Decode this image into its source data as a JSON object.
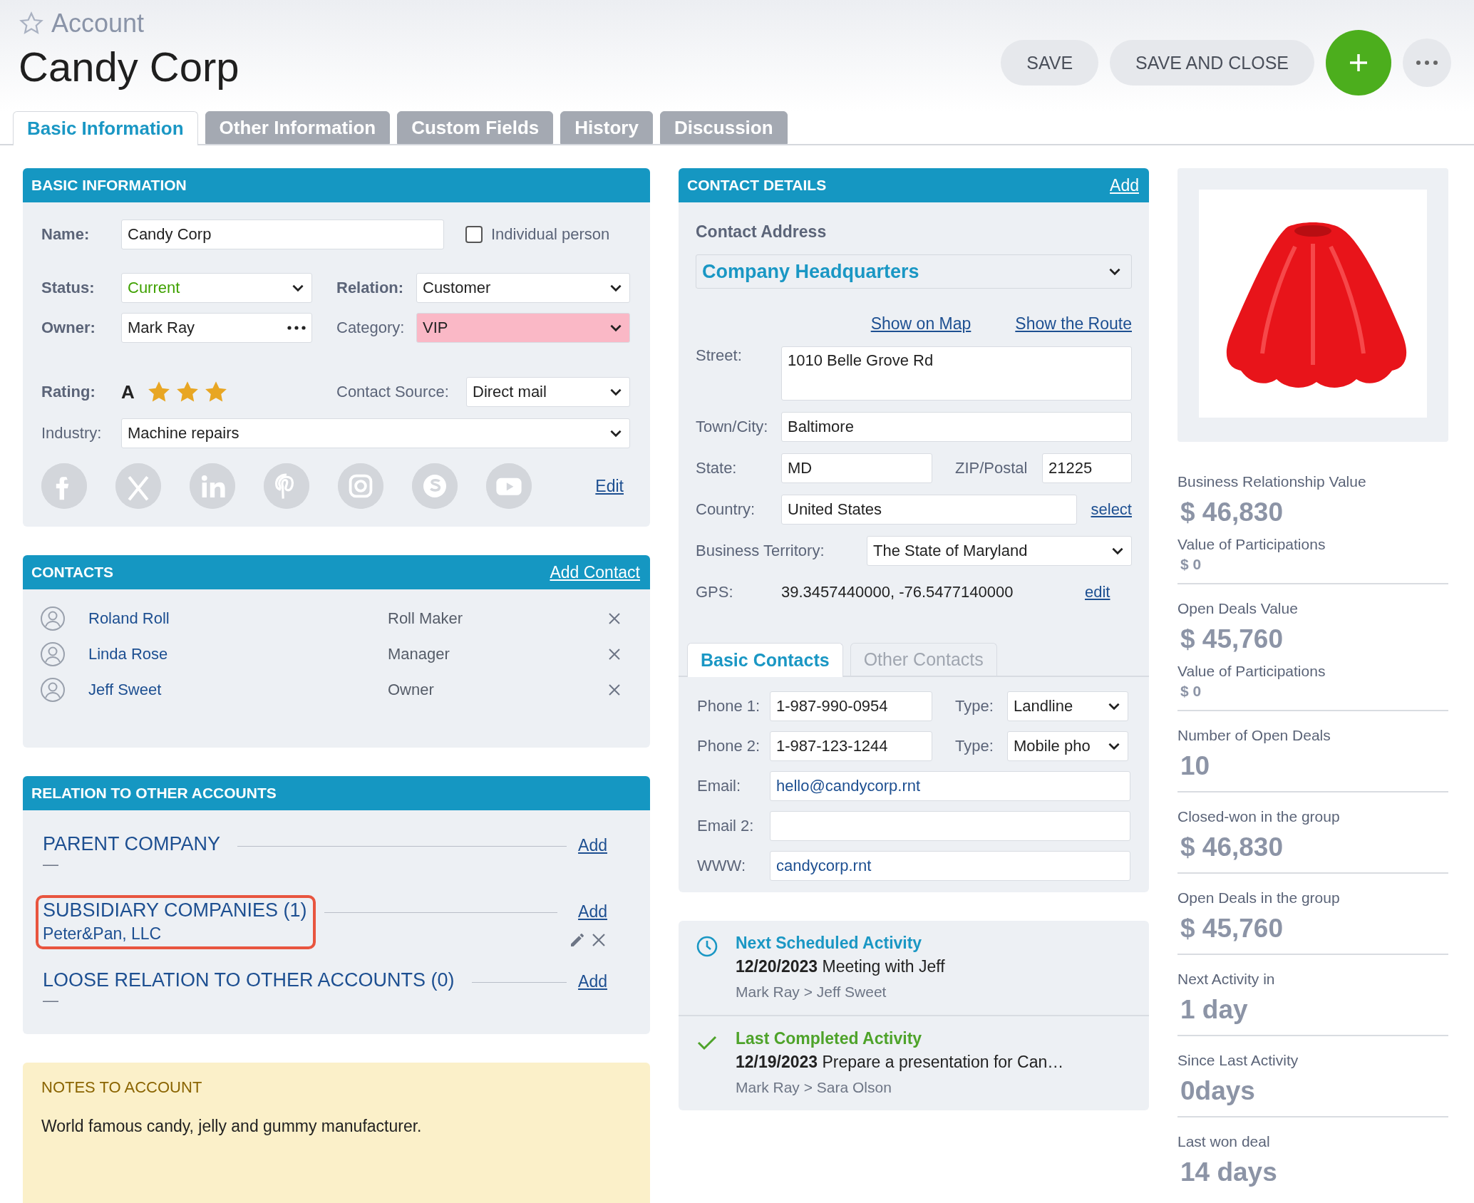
{
  "header": {
    "breadcrumb": "Account",
    "title": "Candy Corp",
    "buttons": [
      "SAVE",
      "SAVE AND CLOSE"
    ]
  },
  "tabs": [
    {
      "label": "Basic Information",
      "selected": true
    },
    {
      "label": "Other Information",
      "selected": false
    },
    {
      "label": "Custom Fields",
      "selected": false
    },
    {
      "label": "History",
      "selected": false
    },
    {
      "label": "Discussion",
      "selected": false
    }
  ],
  "basic_information": {
    "title": "BASIC INFORMATION",
    "name": {
      "label": "Name:",
      "value": "Candy Corp"
    },
    "individual_person": {
      "label": "Individual person",
      "checked": false
    },
    "status": {
      "label": "Status:",
      "value": "Current",
      "color": "#3fa100"
    },
    "relation": {
      "label": "Relation:",
      "value": "Customer"
    },
    "owner": {
      "label": "Owner:",
      "value": "Mark Ray"
    },
    "category": {
      "label": "Category:",
      "value": "VIP",
      "color": "#fab8c6"
    },
    "rating": {
      "label": "Rating:",
      "grade": "A",
      "stars": 3
    },
    "contact_source": {
      "label": "Contact Source:",
      "value": "Direct mail"
    },
    "industry": {
      "label": "Industry:",
      "value": "Machine repairs"
    },
    "edit_link": "Edit"
  },
  "contacts": {
    "title": "CONTACTS",
    "add_link": "Add Contact",
    "rows": [
      {
        "name": "Roland Roll",
        "role": "Roll Maker"
      },
      {
        "name": "Linda Rose",
        "role": "Manager"
      },
      {
        "name": "Jeff Sweet",
        "role": "Owner"
      }
    ]
  },
  "relations": {
    "title": "RELATION TO OTHER ACCOUNTS",
    "sections": [
      {
        "title": "PARENT COMPANY",
        "add_link": "Add",
        "value": "—",
        "highlighted": false
      },
      {
        "title": "SUBSIDIARY COMPANIES (1)",
        "add_link": "Add",
        "items": [
          "Peter&Pan, LLC"
        ],
        "highlighted": true
      },
      {
        "title": "LOOSE RELATION TO OTHER ACCOUNTS (0)",
        "add_link": "Add",
        "value": "—",
        "highlighted": false
      }
    ]
  },
  "notes": {
    "title": "NOTES TO ACCOUNT",
    "text": "World famous candy, jelly and gummy manufacturer."
  },
  "contact_details": {
    "title": "CONTACT DETAILS",
    "add_link": "Add",
    "address_label": "Contact Address",
    "address": "Company Headquarters",
    "links": [
      "Show on Map",
      "Show the Route"
    ],
    "street": {
      "label": "Street:",
      "value": "1010 Belle Grove Rd"
    },
    "city": {
      "label": "Town/City:",
      "value": "Baltimore"
    },
    "state": {
      "label": "State:",
      "value": "MD"
    },
    "zip": {
      "label": "ZIP/Postal",
      "value": "21225"
    },
    "country": {
      "label": "Country:",
      "value": "United States",
      "link": "select"
    },
    "territory": {
      "label": "Business Territory:",
      "value": "The State of Maryland"
    },
    "gps": {
      "label": "GPS:",
      "value": "39.3457440000, -76.5477140000",
      "link": "edit"
    },
    "contact_tabs": [
      {
        "label": "Basic Contacts",
        "selected": true
      },
      {
        "label": "Other Contacts",
        "selected": false
      }
    ],
    "phones": [
      {
        "label": "Phone 1:",
        "value": "1-987-990-0954",
        "type_label": "Type:",
        "type": "Landline"
      },
      {
        "label": "Phone 2:",
        "value": "1-987-123-1244",
        "type_label": "Type:",
        "type": "Mobile pho"
      }
    ],
    "emails": [
      {
        "label": "Email:",
        "value": "hello@candycorp.rnt"
      },
      {
        "label": "Email 2:"
      },
      {
        "label": "WWW:",
        "value": "candycorp.rnt"
      }
    ]
  },
  "activities": [
    {
      "kind": "scheduled",
      "title": "Next Scheduled Activity",
      "text": "**12/20/2023** Meeting with Jeff",
      "people": "Mark Ray > Jeff Sweet"
    },
    {
      "kind": "completed",
      "title": "Last Completed Activity",
      "text": "**12/19/2023** Prepare a presentation for Can…",
      "people": "Mark Ray > Sara Olson"
    }
  ],
  "stats": [
    [
      {
        "label": "Business Relationship Value",
        "value": "$ 46,830",
        "kind": "large"
      },
      {
        "label": "Value of Participations",
        "value": "$ 0",
        "kind": "small"
      }
    ],
    [
      {
        "label": "Open Deals Value",
        "value": "$ 45,760",
        "kind": "large"
      },
      {
        "label": "Value of Participations",
        "value": "$ 0",
        "kind": "small"
      }
    ],
    [
      {
        "label": "Number of Open Deals",
        "value": "10",
        "kind": "large"
      }
    ],
    [
      {
        "label": "Closed-won in the group",
        "value": "$ 46,830",
        "kind": "large"
      }
    ],
    [
      {
        "label": "Open Deals in the group",
        "value": "$ 45,760",
        "kind": "large"
      }
    ],
    [
      {
        "label": "Next Activity in",
        "value": "1 day",
        "kind": "large"
      }
    ],
    [
      {
        "label": "Since Last Activity",
        "value": "0days",
        "kind": "large"
      }
    ],
    [
      {
        "label": "Last won deal",
        "value": "14 days",
        "kind": "large"
      }
    ]
  ]
}
